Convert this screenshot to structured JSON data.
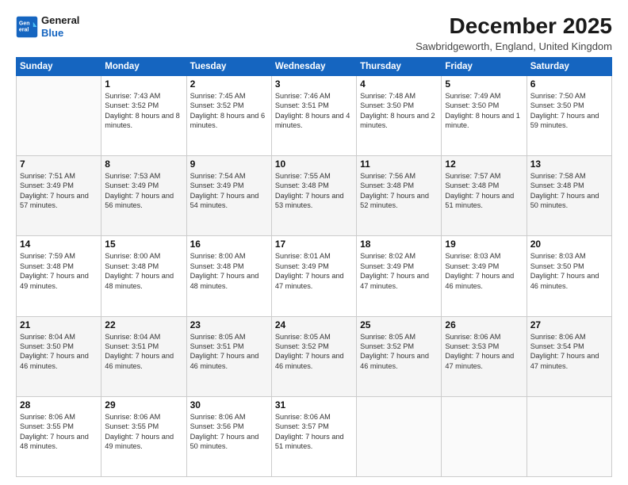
{
  "header": {
    "logo_general": "General",
    "logo_blue": "Blue",
    "month_title": "December 2025",
    "location": "Sawbridgeworth, England, United Kingdom"
  },
  "days_of_week": [
    "Sunday",
    "Monday",
    "Tuesday",
    "Wednesday",
    "Thursday",
    "Friday",
    "Saturday"
  ],
  "weeks": [
    [
      {
        "day": "",
        "sunrise": "",
        "sunset": "",
        "daylight": ""
      },
      {
        "day": "1",
        "sunrise": "Sunrise: 7:43 AM",
        "sunset": "Sunset: 3:52 PM",
        "daylight": "Daylight: 8 hours and 8 minutes."
      },
      {
        "day": "2",
        "sunrise": "Sunrise: 7:45 AM",
        "sunset": "Sunset: 3:52 PM",
        "daylight": "Daylight: 8 hours and 6 minutes."
      },
      {
        "day": "3",
        "sunrise": "Sunrise: 7:46 AM",
        "sunset": "Sunset: 3:51 PM",
        "daylight": "Daylight: 8 hours and 4 minutes."
      },
      {
        "day": "4",
        "sunrise": "Sunrise: 7:48 AM",
        "sunset": "Sunset: 3:50 PM",
        "daylight": "Daylight: 8 hours and 2 minutes."
      },
      {
        "day": "5",
        "sunrise": "Sunrise: 7:49 AM",
        "sunset": "Sunset: 3:50 PM",
        "daylight": "Daylight: 8 hours and 1 minute."
      },
      {
        "day": "6",
        "sunrise": "Sunrise: 7:50 AM",
        "sunset": "Sunset: 3:50 PM",
        "daylight": "Daylight: 7 hours and 59 minutes."
      }
    ],
    [
      {
        "day": "7",
        "sunrise": "Sunrise: 7:51 AM",
        "sunset": "Sunset: 3:49 PM",
        "daylight": "Daylight: 7 hours and 57 minutes."
      },
      {
        "day": "8",
        "sunrise": "Sunrise: 7:53 AM",
        "sunset": "Sunset: 3:49 PM",
        "daylight": "Daylight: 7 hours and 56 minutes."
      },
      {
        "day": "9",
        "sunrise": "Sunrise: 7:54 AM",
        "sunset": "Sunset: 3:49 PM",
        "daylight": "Daylight: 7 hours and 54 minutes."
      },
      {
        "day": "10",
        "sunrise": "Sunrise: 7:55 AM",
        "sunset": "Sunset: 3:48 PM",
        "daylight": "Daylight: 7 hours and 53 minutes."
      },
      {
        "day": "11",
        "sunrise": "Sunrise: 7:56 AM",
        "sunset": "Sunset: 3:48 PM",
        "daylight": "Daylight: 7 hours and 52 minutes."
      },
      {
        "day": "12",
        "sunrise": "Sunrise: 7:57 AM",
        "sunset": "Sunset: 3:48 PM",
        "daylight": "Daylight: 7 hours and 51 minutes."
      },
      {
        "day": "13",
        "sunrise": "Sunrise: 7:58 AM",
        "sunset": "Sunset: 3:48 PM",
        "daylight": "Daylight: 7 hours and 50 minutes."
      }
    ],
    [
      {
        "day": "14",
        "sunrise": "Sunrise: 7:59 AM",
        "sunset": "Sunset: 3:48 PM",
        "daylight": "Daylight: 7 hours and 49 minutes."
      },
      {
        "day": "15",
        "sunrise": "Sunrise: 8:00 AM",
        "sunset": "Sunset: 3:48 PM",
        "daylight": "Daylight: 7 hours and 48 minutes."
      },
      {
        "day": "16",
        "sunrise": "Sunrise: 8:00 AM",
        "sunset": "Sunset: 3:48 PM",
        "daylight": "Daylight: 7 hours and 48 minutes."
      },
      {
        "day": "17",
        "sunrise": "Sunrise: 8:01 AM",
        "sunset": "Sunset: 3:49 PM",
        "daylight": "Daylight: 7 hours and 47 minutes."
      },
      {
        "day": "18",
        "sunrise": "Sunrise: 8:02 AM",
        "sunset": "Sunset: 3:49 PM",
        "daylight": "Daylight: 7 hours and 47 minutes."
      },
      {
        "day": "19",
        "sunrise": "Sunrise: 8:03 AM",
        "sunset": "Sunset: 3:49 PM",
        "daylight": "Daylight: 7 hours and 46 minutes."
      },
      {
        "day": "20",
        "sunrise": "Sunrise: 8:03 AM",
        "sunset": "Sunset: 3:50 PM",
        "daylight": "Daylight: 7 hours and 46 minutes."
      }
    ],
    [
      {
        "day": "21",
        "sunrise": "Sunrise: 8:04 AM",
        "sunset": "Sunset: 3:50 PM",
        "daylight": "Daylight: 7 hours and 46 minutes."
      },
      {
        "day": "22",
        "sunrise": "Sunrise: 8:04 AM",
        "sunset": "Sunset: 3:51 PM",
        "daylight": "Daylight: 7 hours and 46 minutes."
      },
      {
        "day": "23",
        "sunrise": "Sunrise: 8:05 AM",
        "sunset": "Sunset: 3:51 PM",
        "daylight": "Daylight: 7 hours and 46 minutes."
      },
      {
        "day": "24",
        "sunrise": "Sunrise: 8:05 AM",
        "sunset": "Sunset: 3:52 PM",
        "daylight": "Daylight: 7 hours and 46 minutes."
      },
      {
        "day": "25",
        "sunrise": "Sunrise: 8:05 AM",
        "sunset": "Sunset: 3:52 PM",
        "daylight": "Daylight: 7 hours and 46 minutes."
      },
      {
        "day": "26",
        "sunrise": "Sunrise: 8:06 AM",
        "sunset": "Sunset: 3:53 PM",
        "daylight": "Daylight: 7 hours and 47 minutes."
      },
      {
        "day": "27",
        "sunrise": "Sunrise: 8:06 AM",
        "sunset": "Sunset: 3:54 PM",
        "daylight": "Daylight: 7 hours and 47 minutes."
      }
    ],
    [
      {
        "day": "28",
        "sunrise": "Sunrise: 8:06 AM",
        "sunset": "Sunset: 3:55 PM",
        "daylight": "Daylight: 7 hours and 48 minutes."
      },
      {
        "day": "29",
        "sunrise": "Sunrise: 8:06 AM",
        "sunset": "Sunset: 3:55 PM",
        "daylight": "Daylight: 7 hours and 49 minutes."
      },
      {
        "day": "30",
        "sunrise": "Sunrise: 8:06 AM",
        "sunset": "Sunset: 3:56 PM",
        "daylight": "Daylight: 7 hours and 50 minutes."
      },
      {
        "day": "31",
        "sunrise": "Sunrise: 8:06 AM",
        "sunset": "Sunset: 3:57 PM",
        "daylight": "Daylight: 7 hours and 51 minutes."
      },
      {
        "day": "",
        "sunrise": "",
        "sunset": "",
        "daylight": ""
      },
      {
        "day": "",
        "sunrise": "",
        "sunset": "",
        "daylight": ""
      },
      {
        "day": "",
        "sunrise": "",
        "sunset": "",
        "daylight": ""
      }
    ]
  ]
}
